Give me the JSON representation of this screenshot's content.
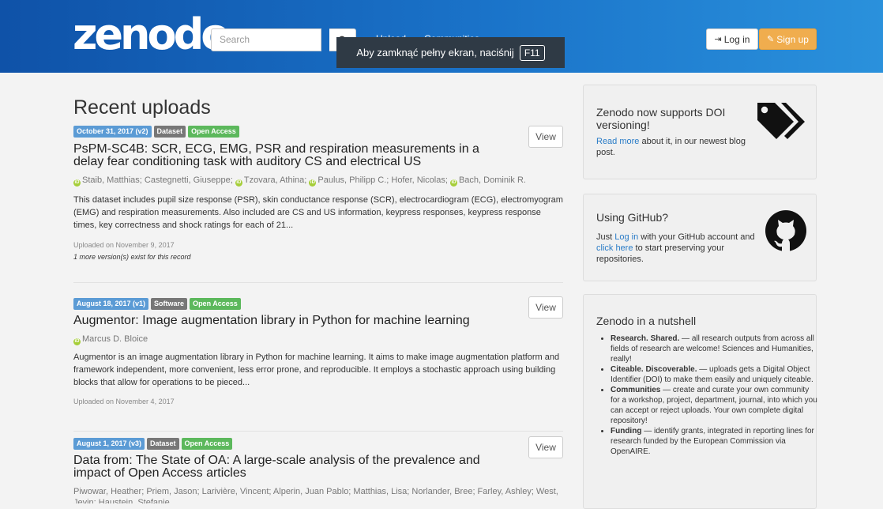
{
  "header": {
    "logo": "zenodo",
    "search_placeholder": "Search",
    "nav": {
      "upload": "Upload",
      "communities": "Communities"
    },
    "login": "Log in",
    "signup": "Sign up"
  },
  "fullscreen_notice": {
    "text": "Aby zamknąć pełny ekran, naciśnij",
    "key": "F11"
  },
  "main": {
    "title": "Recent uploads",
    "view_label": "View",
    "records": [
      {
        "date": "October 31, 2017 (v2)",
        "type": "Dataset",
        "access": "Open Access",
        "title": "PsPM-SC4B: SCR, ECG, EMG, PSR and respiration measurements in a delay fear conditioning task with auditory CS and electrical US",
        "authors": [
          {
            "name": "Staib, Matthias;",
            "orcid": true
          },
          {
            "name": "Castegnetti, Giuseppe;",
            "orcid": false
          },
          {
            "name": "Tzovara, Athina;",
            "orcid": true
          },
          {
            "name": "Paulus, Philipp C.;",
            "orcid": false
          },
          {
            "name": "Hofer, Nicolas;",
            "orcid": false
          },
          {
            "name": "Bach, Dominik R.",
            "orcid": true
          }
        ],
        "description": "This dataset includes pupil size response (PSR), skin conductance response (SCR), electrocardiogram (ECG), electromyogram (EMG) and respiration measurements. Also included are CS and US information, keypress responses, keypress response times, key correctness and shock ratings for each of 21...",
        "uploaded": "Uploaded on November 9, 2017",
        "versions": "1 more version(s) exist for this record"
      },
      {
        "date": "August 18, 2017 (v1)",
        "type": "Software",
        "access": "Open Access",
        "title": "Augmentor: Image augmentation library in Python for machine learning",
        "authors": [
          {
            "name": "Marcus D. Bloice",
            "orcid": true
          }
        ],
        "description": "Augmentor is an image augmentation library in Python for machine learning. It aims to make image augmentation platform and framework independent, more convenient, less error prone, and reproducible. It employs a stochastic approach using building blocks that allow for operations to be pieced...",
        "uploaded": "Uploaded on November 4, 2017",
        "versions": ""
      },
      {
        "date": "August 1, 2017 (v3)",
        "type": "Dataset",
        "access": "Open Access",
        "title": "Data from: The State of OA: A large-scale analysis of the prevalence and impact of Open Access articles",
        "authors_text": "Piwowar, Heather; Priem, Jason; Larivière, Vincent; Alperin, Juan Pablo; Matthias, Lisa; Norlander, Bree; Farley, Ashley; West, Jevin; Haustein, Stefanie"
      }
    ]
  },
  "sidebar": {
    "doi": {
      "heading": "Zenodo now supports DOI versioning!",
      "link": "Read more",
      "text": " about it, in our newest blog post."
    },
    "github": {
      "heading": "Using GitHub?",
      "pre": "Just ",
      "login_link": "Log in",
      "mid": " with your GitHub account and ",
      "click_link": "click here",
      "post": " to start preserving your repositories."
    },
    "nutshell": {
      "heading": "Zenodo in a nutshell",
      "items": [
        {
          "bold": "Research. Shared.",
          "text": " — all research outputs from across all fields of research are welcome! Sciences and Humanities, really!"
        },
        {
          "bold": "Citeable. Discoverable.",
          "text": " — uploads gets a Digital Object Identifier (DOI) to make them easily and uniquely citeable."
        },
        {
          "bold": "Communities",
          "text": " — create and curate your own community for a workshop, project, department, journal, into which you can accept or reject uploads. Your own complete digital repository!"
        },
        {
          "bold": "Funding",
          "text": " — identify grants, integrated in reporting lines for research funded by the European Commission via OpenAIRE."
        }
      ]
    }
  }
}
